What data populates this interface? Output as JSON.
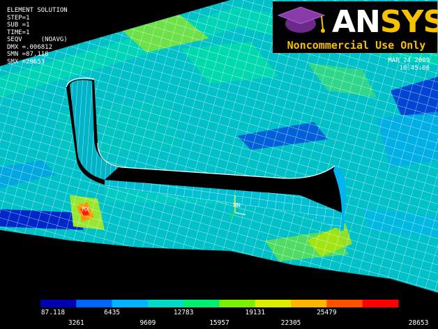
{
  "info_lines": [
    "ELEMENT SOLUTION",
    "STEP=1",
    "SUB =1",
    "TIME=1",
    "SEQV     (NOAVG)",
    "DMX =.006812",
    "SMN =87.118",
    "SMX =28653"
  ],
  "logo": {
    "an": "AN",
    "sys": "SYS",
    "banner": "Noncommercial Use Only"
  },
  "datetime": {
    "date": "MAR 24 2009",
    "time": "10:45:06"
  },
  "legend": {
    "colors": [
      "#0000b4",
      "#0064ff",
      "#00b4ff",
      "#00dcc8",
      "#00f06e",
      "#78f000",
      "#dcf000",
      "#ffb400",
      "#ff5000",
      "#ff0000"
    ],
    "labels_top": [
      "87.118",
      "6435",
      "12783",
      "19131",
      "25479"
    ],
    "labels_bottom": [
      "3261",
      "9609",
      "15957",
      "22305",
      "28653"
    ]
  },
  "markers": {
    "mn": "MN",
    "mx": "MX"
  }
}
